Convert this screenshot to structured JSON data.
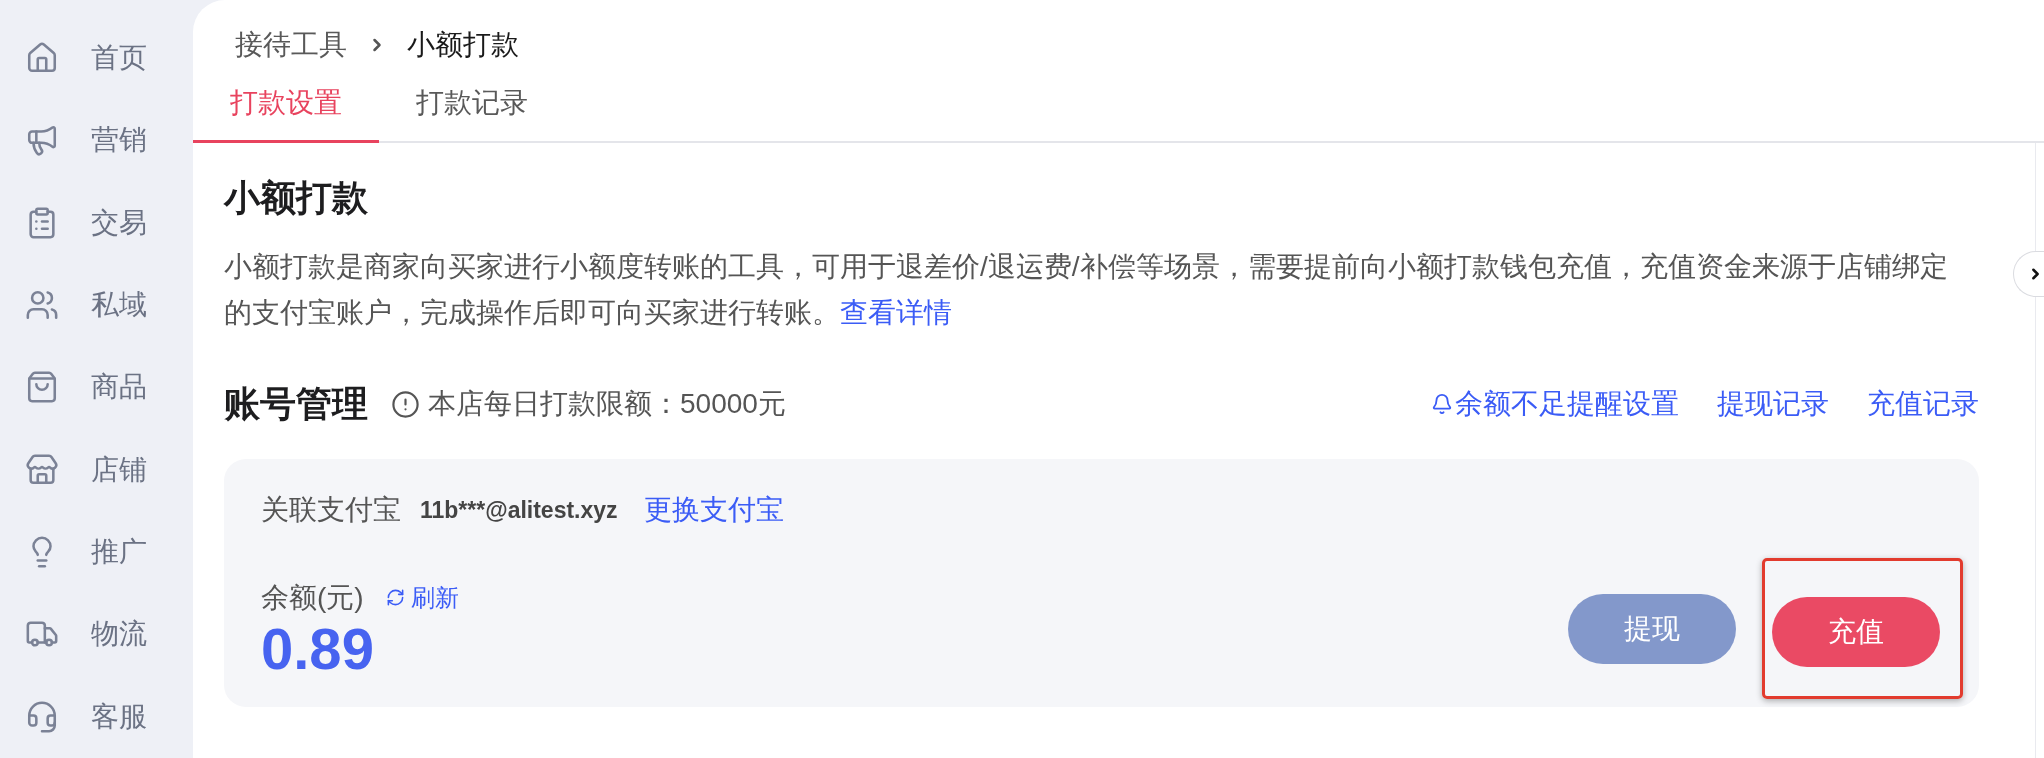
{
  "sidebar": {
    "items": [
      {
        "label": "首页"
      },
      {
        "label": "营销"
      },
      {
        "label": "交易"
      },
      {
        "label": "私域"
      },
      {
        "label": "商品"
      },
      {
        "label": "店铺"
      },
      {
        "label": "推广"
      },
      {
        "label": "物流"
      },
      {
        "label": "客服"
      }
    ]
  },
  "breadcrumb": [
    "接待工具",
    "小额打款"
  ],
  "tabs": [
    {
      "label": "打款设置",
      "selected": true
    },
    {
      "label": "打款记录",
      "selected": false
    }
  ],
  "intro": {
    "title": "小额打款",
    "text": "小额打款是商家向买家进行小额度转账的工具，可用于退差价/退运费/补偿等场景，需要提前向小额打款钱包充值，充值资金来源于店铺绑定的支付宝账户，完成操作后即可向买家进行转账。",
    "link": "查看详情"
  },
  "account": {
    "title": "账号管理",
    "limit_note": "本店每日打款限额：50000元",
    "links": [
      {
        "label": "余额不足提醒设置",
        "kind": "bell"
      },
      {
        "label": "提现记录",
        "kind": "plain"
      },
      {
        "label": "充值记录",
        "kind": "plain"
      }
    ]
  },
  "card": {
    "alipay_label": "关联支付宝",
    "alipay_account": "11b***@alitest.xyz",
    "change_link": "更换支付宝",
    "balance_label": "余额(元)",
    "refresh": "刷新",
    "balance": "0.89",
    "buttons": [
      {
        "label": "提现",
        "kind": "secondary",
        "highlighted": false
      },
      {
        "label": "充值",
        "kind": "primary",
        "highlighted": true
      }
    ]
  }
}
